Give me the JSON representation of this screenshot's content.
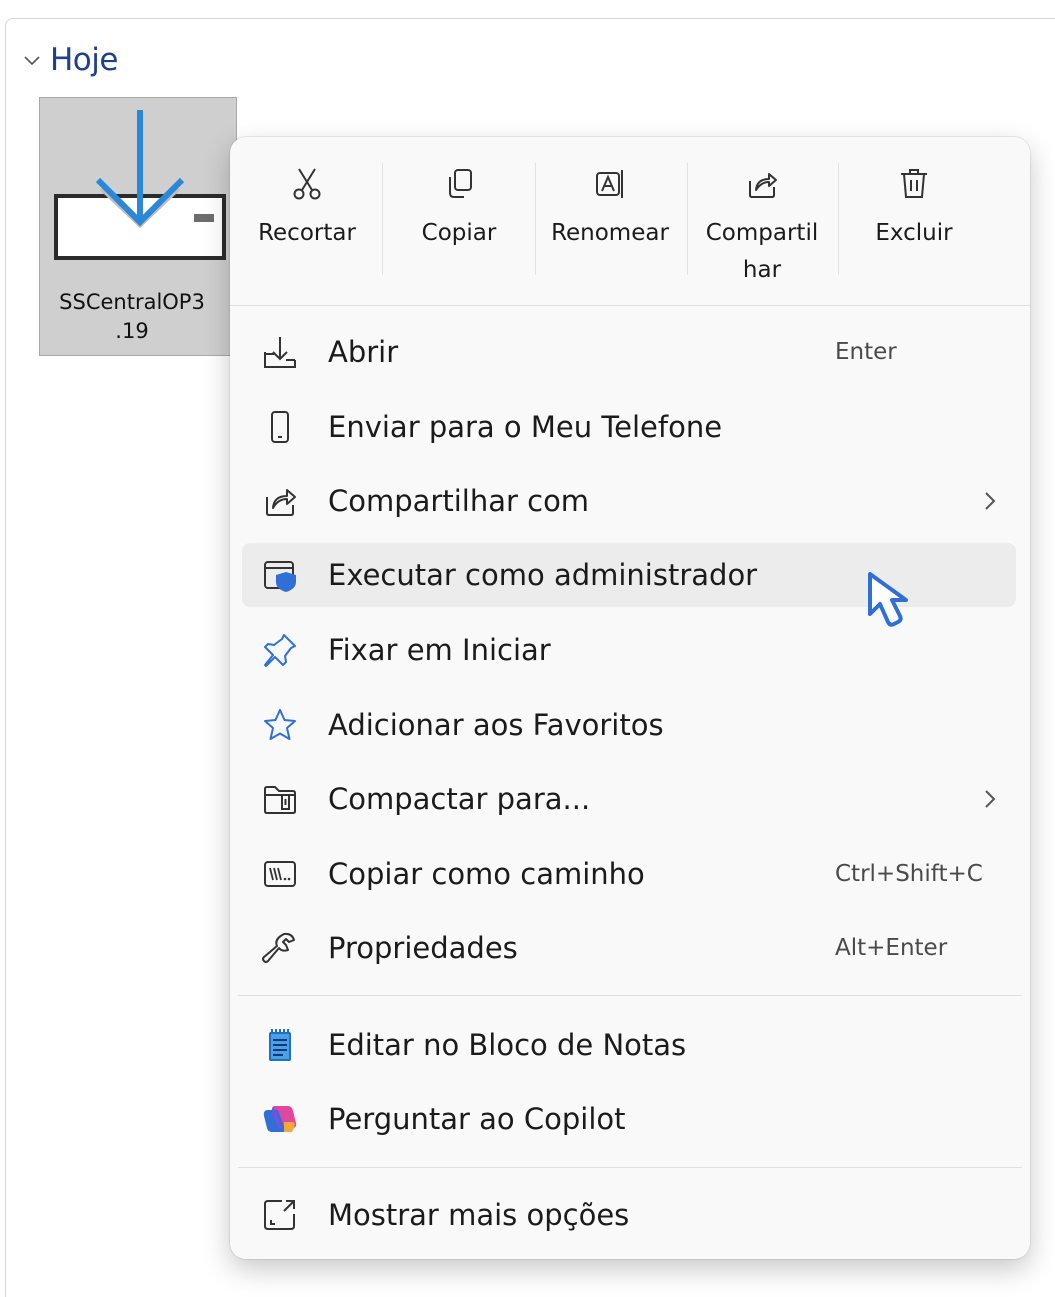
{
  "group": {
    "title": "Hoje"
  },
  "file": {
    "name": "SSCentralOP3 .19"
  },
  "toolbar": [
    {
      "label": "Recortar",
      "icon": "cut-icon"
    },
    {
      "label": "Copiar",
      "icon": "copy-icon"
    },
    {
      "label": "Renomear",
      "icon": "rename-icon"
    },
    {
      "label": "Compartil har",
      "icon": "share-icon"
    },
    {
      "label": "Excluir",
      "icon": "delete-icon"
    }
  ],
  "menu": {
    "items": [
      {
        "label": "Abrir",
        "shortcut": "Enter",
        "icon": "open-icon"
      },
      {
        "label": "Enviar para o Meu Telefone",
        "icon": "phone-icon"
      },
      {
        "label": "Compartilhar com",
        "icon": "share-icon",
        "submenu": true
      },
      {
        "label": "Executar como administrador",
        "icon": "shield-icon",
        "hovered": true
      },
      {
        "label": "Fixar em Iniciar",
        "icon": "pin-icon"
      },
      {
        "label": "Adicionar aos Favoritos",
        "icon": "star-icon"
      },
      {
        "label": "Compactar para...",
        "icon": "zip-folder-icon",
        "submenu": true
      },
      {
        "label": "Copiar como caminho",
        "shortcut": "Ctrl+Shift+C",
        "icon": "path-icon"
      },
      {
        "label": "Propriedades",
        "shortcut": "Alt+Enter",
        "icon": "wrench-icon"
      },
      {
        "label": "Editar no Bloco de Notas",
        "icon": "notepad-icon"
      },
      {
        "label": "Perguntar ao Copilot",
        "icon": "copilot-icon"
      },
      {
        "label": "Mostrar mais opções",
        "icon": "more-options-icon"
      }
    ]
  },
  "colors": {
    "accent": "#2f6fd6",
    "group_title": "#1f3f8f",
    "hover": "#ececec",
    "menu_bg": "#f9f9f9",
    "tile_bg": "#cfcfcf"
  }
}
